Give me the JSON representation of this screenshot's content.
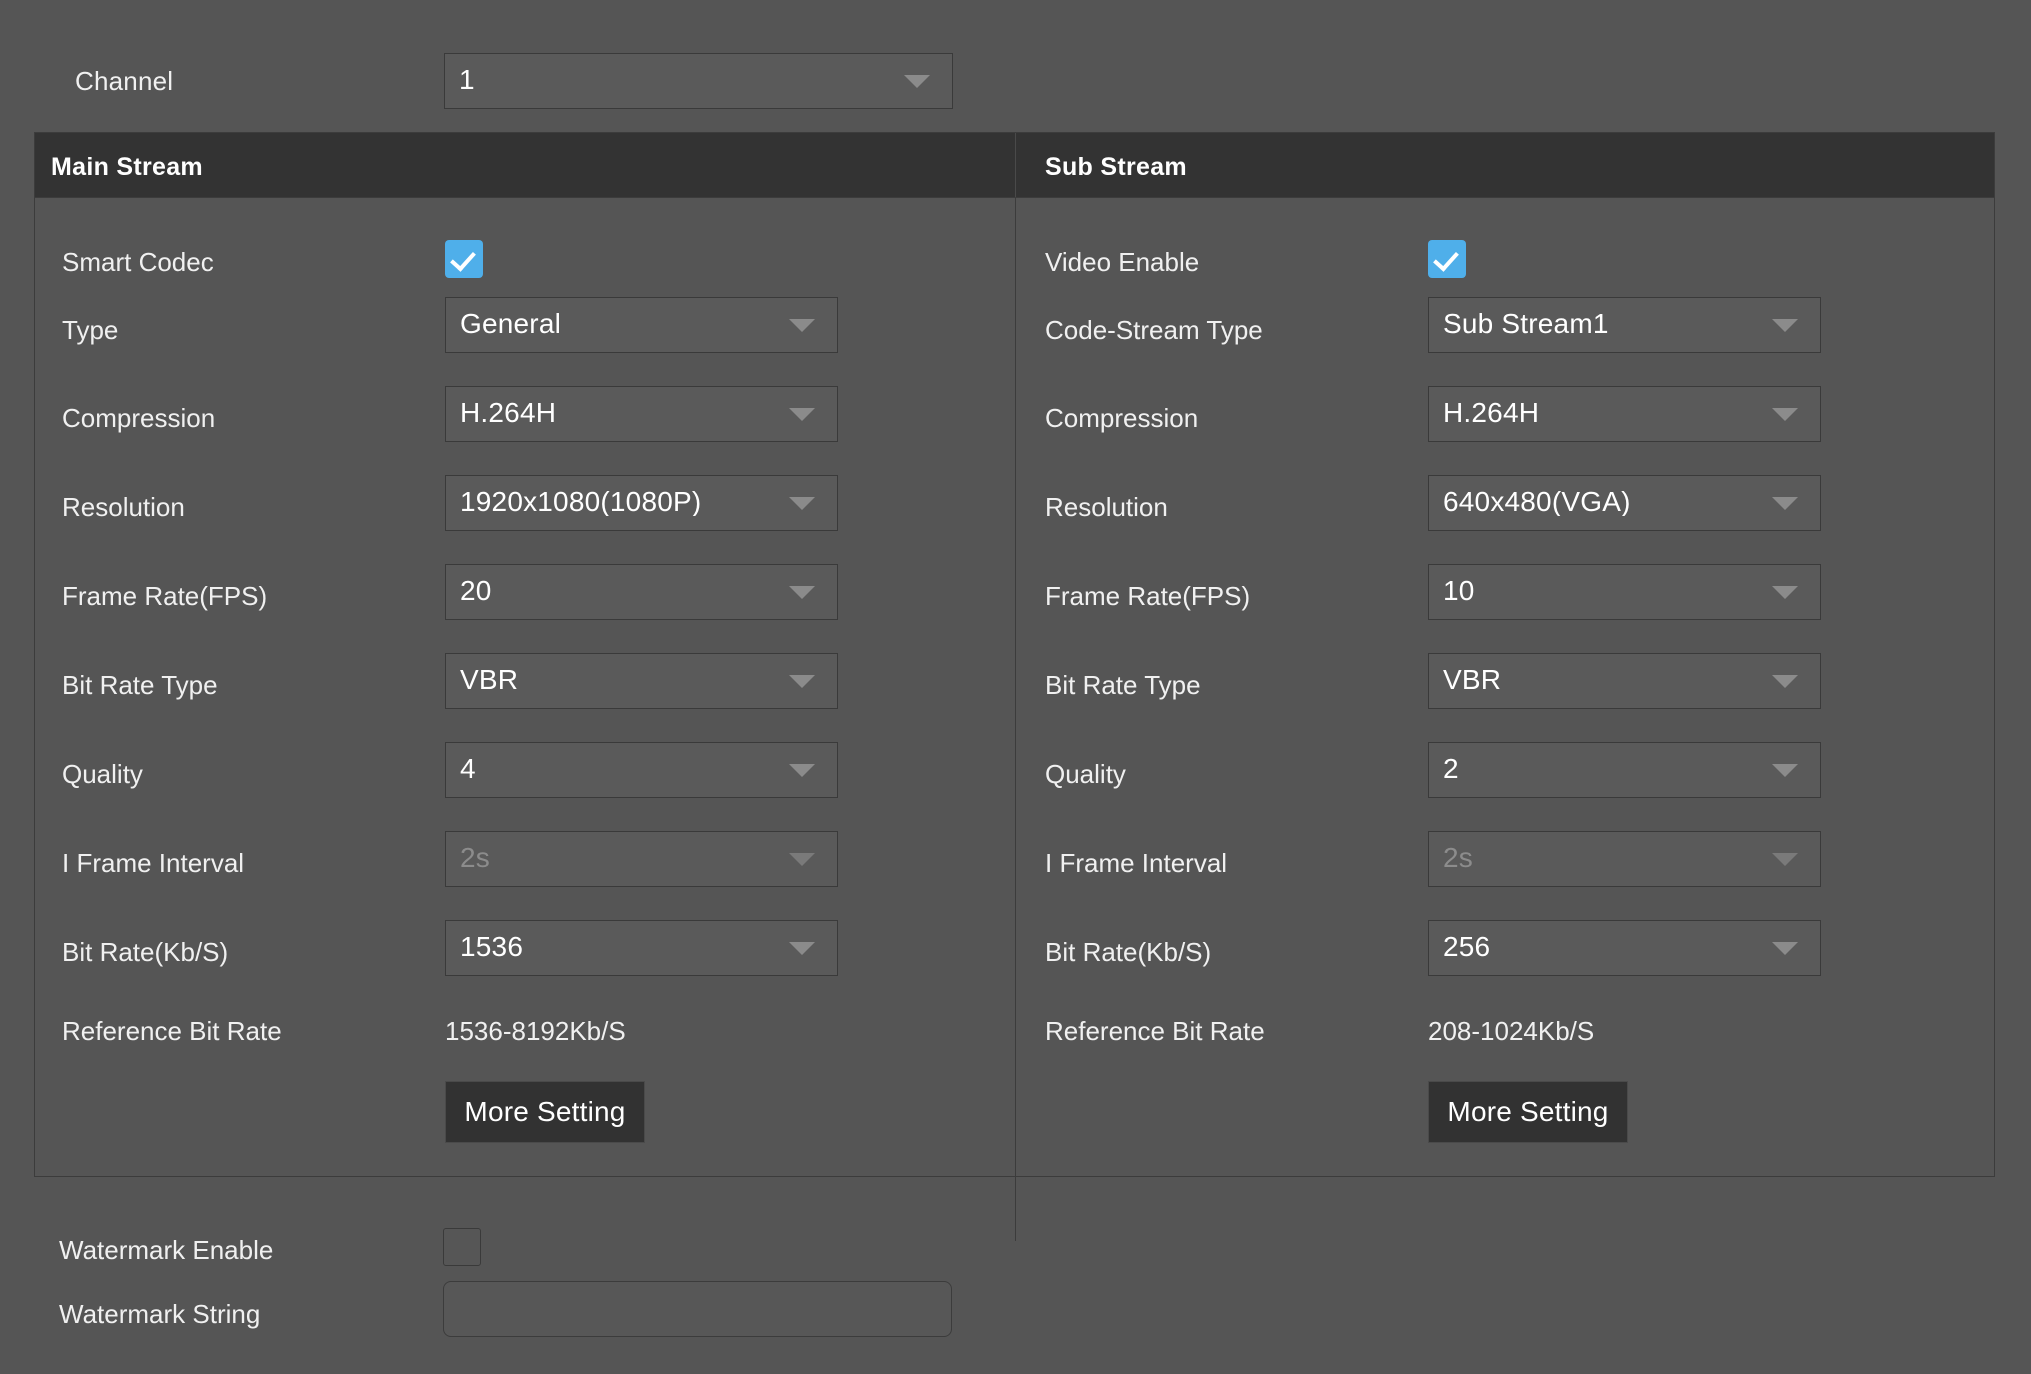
{
  "channel": {
    "label": "Channel",
    "value": "1",
    "caret_icon": "chevron-down-icon"
  },
  "main_stream": {
    "title": "Main Stream",
    "smart_codec": {
      "label": "Smart Codec",
      "checked": true
    },
    "fields": [
      {
        "label": "Type",
        "value": "General",
        "disabled": false
      },
      {
        "label": "Compression",
        "value": "H.264H",
        "disabled": false
      },
      {
        "label": "Resolution",
        "value": "1920x1080(1080P)",
        "disabled": false
      },
      {
        "label": "Frame Rate(FPS)",
        "value": "20",
        "disabled": false
      },
      {
        "label": "Bit Rate Type",
        "value": "VBR",
        "disabled": false
      },
      {
        "label": "Quality",
        "value": "4",
        "disabled": false
      },
      {
        "label": "I Frame Interval",
        "value": "2s",
        "disabled": true
      },
      {
        "label": "Bit Rate(Kb/S)",
        "value": "1536",
        "disabled": false
      }
    ],
    "reference_bit_rate": {
      "label": "Reference Bit Rate",
      "value": "1536-8192Kb/S"
    },
    "more_setting_label": "More Setting"
  },
  "sub_stream": {
    "title": "Sub Stream",
    "video_enable": {
      "label": "Video Enable",
      "checked": true
    },
    "fields": [
      {
        "label": "Code-Stream Type",
        "value": "Sub Stream1",
        "disabled": false
      },
      {
        "label": "Compression",
        "value": "H.264H",
        "disabled": false
      },
      {
        "label": "Resolution",
        "value": "640x480(VGA)",
        "disabled": false
      },
      {
        "label": "Frame Rate(FPS)",
        "value": "10",
        "disabled": false
      },
      {
        "label": "Bit Rate Type",
        "value": "VBR",
        "disabled": false
      },
      {
        "label": "Quality",
        "value": "2",
        "disabled": false
      },
      {
        "label": "I Frame Interval",
        "value": "2s",
        "disabled": true
      },
      {
        "label": "Bit Rate(Kb/S)",
        "value": "256",
        "disabled": false
      }
    ],
    "reference_bit_rate": {
      "label": "Reference Bit Rate",
      "value": "208-1024Kb/S"
    },
    "more_setting_label": "More Setting"
  },
  "watermark": {
    "enable": {
      "label": "Watermark Enable",
      "checked": false
    },
    "string": {
      "label": "Watermark String",
      "value": "",
      "placeholder": ""
    }
  },
  "colors": {
    "page_background": "#555555",
    "panel_header": "#333333",
    "field_background": "#5a5a5a",
    "field_border": "#3a3a3a",
    "checkbox_accent": "#4FAFEA",
    "button_background": "#323232",
    "text": "#f0f0f0",
    "disabled_text": "#8c8c8c",
    "caret": "#8b8b8b"
  }
}
